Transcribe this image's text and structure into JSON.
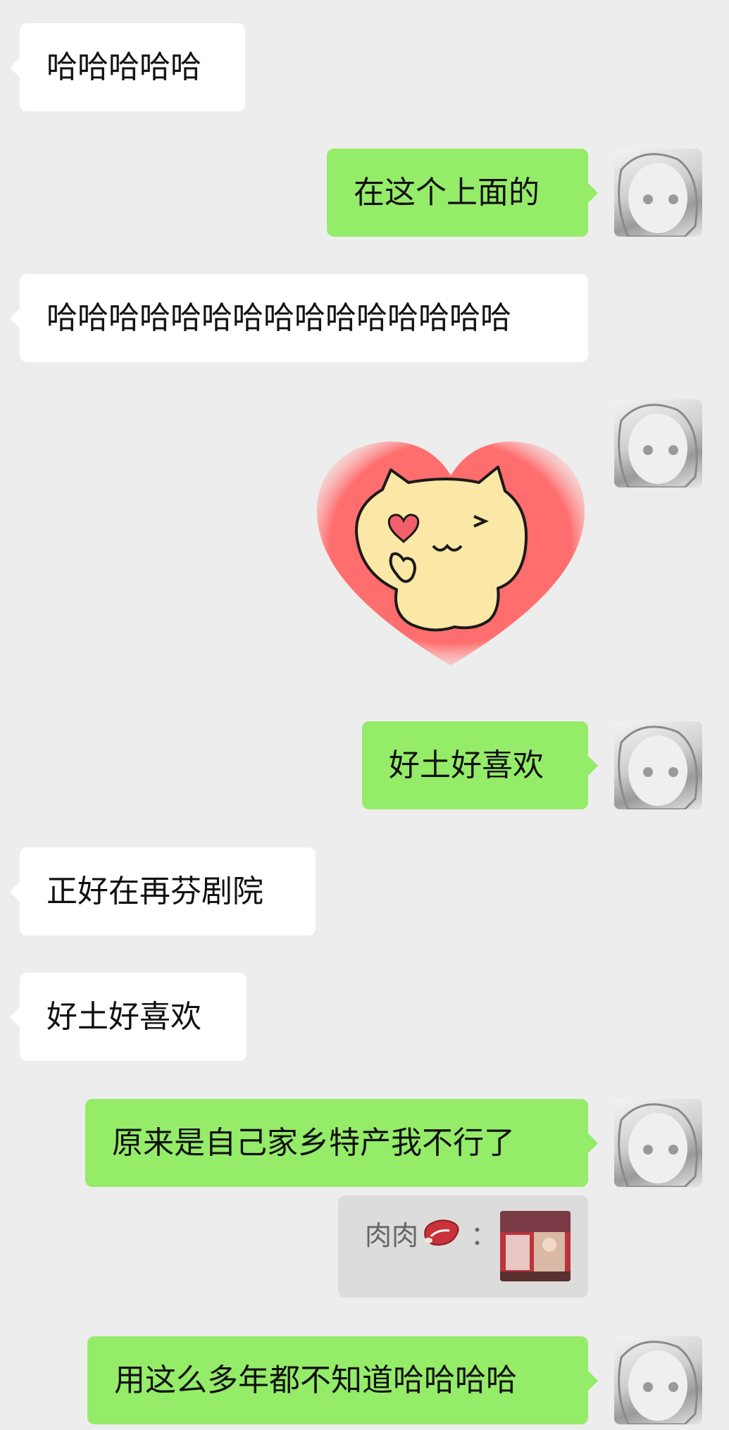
{
  "messages": [
    {
      "side": "left",
      "text": "哈哈哈哈哈"
    },
    {
      "side": "right",
      "text": "在这个上面的"
    },
    {
      "side": "left",
      "text": "哈哈哈哈哈哈哈哈哈哈哈哈哈哈哈"
    },
    {
      "side": "right",
      "type": "sticker",
      "sticker": "heart-cat-sticker"
    },
    {
      "side": "right",
      "text": "好土好喜欢"
    },
    {
      "side": "left",
      "text": "正好在再芬剧院"
    },
    {
      "side": "left",
      "text": "好土好喜欢"
    },
    {
      "side": "right",
      "text": "原来是自己家乡特产我不行了"
    },
    {
      "side": "right",
      "type": "quote",
      "quote_author": "肉肉",
      "quote_icon": "meat-icon",
      "quote_separator": "："
    },
    {
      "side": "right",
      "text": "用这么多年都不知道哈哈哈哈"
    }
  ],
  "colors": {
    "background": "#ededed",
    "left_bubble": "#ffffff",
    "right_bubble": "#95ec69",
    "quote_background": "#dcdcdc"
  }
}
